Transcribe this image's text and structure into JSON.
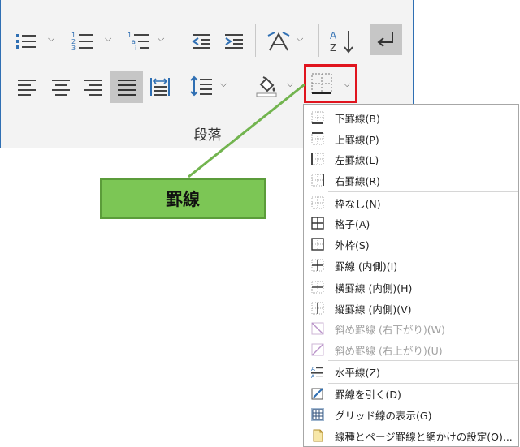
{
  "ribbon": {
    "group_label": "段落"
  },
  "callout": {
    "label": "罫線"
  },
  "menu": {
    "items": [
      {
        "label": "下罫線(B)",
        "icon": "border-bottom-icon",
        "enabled": true
      },
      {
        "label": "上罫線(P)",
        "icon": "border-top-icon",
        "enabled": true
      },
      {
        "label": "左罫線(L)",
        "icon": "border-left-icon",
        "enabled": true
      },
      {
        "label": "右罫線(R)",
        "icon": "border-right-icon",
        "enabled": true
      },
      {
        "label": "枠なし(N)",
        "icon": "no-border-icon",
        "enabled": true
      },
      {
        "label": "格子(A)",
        "icon": "all-borders-icon",
        "enabled": true
      },
      {
        "label": "外枠(S)",
        "icon": "outside-borders-icon",
        "enabled": true
      },
      {
        "label": "罫線 (内側)(I)",
        "icon": "inside-borders-icon",
        "enabled": true
      },
      {
        "label": "横罫線 (内側)(H)",
        "icon": "inside-horizontal-border-icon",
        "enabled": true
      },
      {
        "label": "縦罫線 (内側)(V)",
        "icon": "inside-vertical-border-icon",
        "enabled": true
      },
      {
        "label": "斜め罫線 (右下がり)(W)",
        "icon": "diagonal-down-border-icon",
        "enabled": false
      },
      {
        "label": "斜め罫線 (右上がり)(U)",
        "icon": "diagonal-up-border-icon",
        "enabled": false
      },
      {
        "label": "水平線(Z)",
        "icon": "horizontal-line-icon",
        "enabled": true
      },
      {
        "label": "罫線を引く(D)",
        "icon": "draw-table-icon",
        "enabled": true
      },
      {
        "label": "グリッド線の表示(G)",
        "icon": "view-gridlines-icon",
        "enabled": true
      },
      {
        "label": "線種とページ罫線と網かけの設定(O)...",
        "icon": "borders-shading-icon",
        "enabled": true
      }
    ]
  },
  "colors": {
    "accent": "#2f6fb3",
    "highlight": "#e0141e",
    "callout": "#7cc655"
  }
}
